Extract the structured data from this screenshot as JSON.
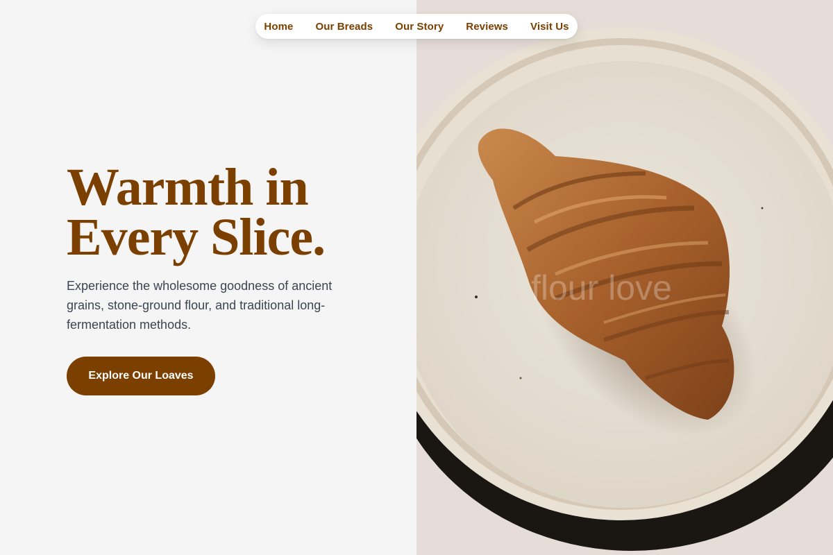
{
  "nav": {
    "items": [
      {
        "label": "Home"
      },
      {
        "label": "Our Breads"
      },
      {
        "label": "Our Story"
      },
      {
        "label": "Reviews"
      },
      {
        "label": "Visit Us"
      }
    ]
  },
  "hero": {
    "title_line1": "Warmth in",
    "title_line2": "Every Slice.",
    "subtitle": "Experience the wholesome goodness of ancient grains, stone-ground flour, and traditional long-fermentation methods.",
    "cta_label": "Explore Our Loaves"
  },
  "image": {
    "watermark": "flour love",
    "subject": "croissant on a ceramic plate"
  },
  "colors": {
    "brand": "#7b3f00",
    "background": "#f5f5f5",
    "text_body": "#3d4451"
  }
}
